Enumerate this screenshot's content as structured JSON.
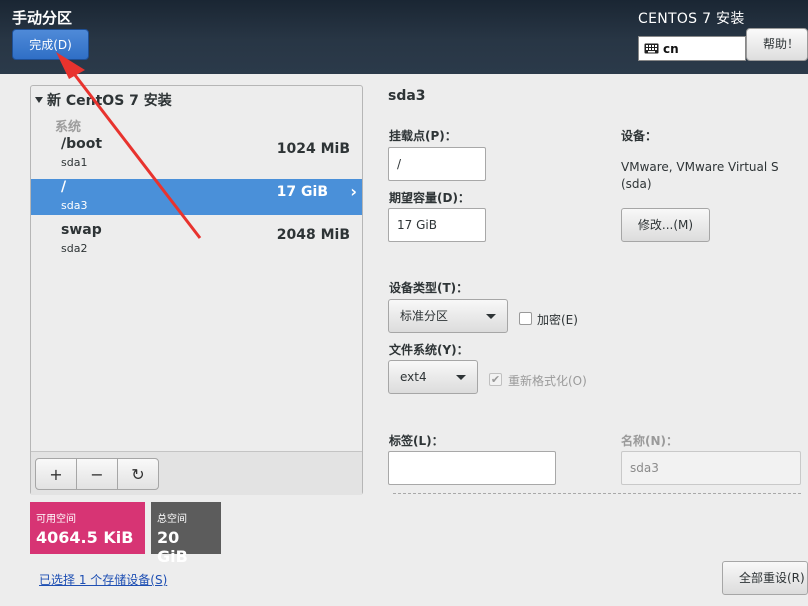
{
  "header": {
    "page_title": "手动分区",
    "install_title": "CENTOS 7 安装",
    "done_label": "完成(D)",
    "keyboard_layout": "cn",
    "help_label": "帮助！"
  },
  "partitions": {
    "group_title": "新 CentOS 7 安装",
    "category": "系统",
    "items": [
      {
        "mount": "/boot",
        "device": "sda1",
        "size": "1024 MiB",
        "selected": false
      },
      {
        "mount": "/",
        "device": "sda3",
        "size": "17 GiB",
        "selected": true
      },
      {
        "mount": "swap",
        "device": "sda2",
        "size": "2048 MiB",
        "selected": false
      }
    ],
    "toolbar": {
      "add": "+",
      "remove": "−",
      "refresh": "↻"
    }
  },
  "space": {
    "available_label": "可用空间",
    "available_value": "4064.5 KiB",
    "total_label": "总空间",
    "total_value": "20 GiB"
  },
  "storage_link": "已选择 1 个存储设备(S)",
  "details": {
    "title": "sda3",
    "mount_point_label": "挂载点(P)：",
    "mount_point_value": "/",
    "capacity_label": "期望容量(D)：",
    "capacity_value": "17 GiB",
    "device_label": "设备：",
    "device_value": "VMware, VMware Virtual S (sda)",
    "modify_label": "修改...(M)",
    "device_type_label": "设备类型(T)：",
    "device_type_value": "标准分区",
    "encrypt_label": "加密(E)",
    "fs_label": "文件系统(Y)：",
    "fs_value": "ext4",
    "reformat_label": "重新格式化(O)",
    "tag_label": "标签(L)：",
    "tag_value": "",
    "name_label": "名称(N)：",
    "name_value": "sda3",
    "reset_all_label": "全部重设(R)"
  },
  "colors": {
    "header_bg": "#283645",
    "selection": "#4a90d9",
    "available_bg": "#d73474",
    "total_bg": "#5c5c5c",
    "annotation_arrow": "#e8332e"
  }
}
